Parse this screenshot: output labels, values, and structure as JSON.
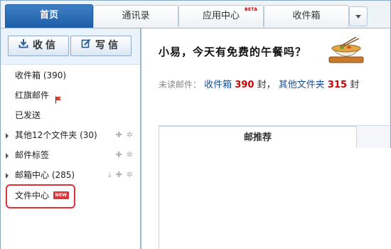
{
  "tabs": [
    {
      "label": "首页",
      "active": true
    },
    {
      "label": "通讯录",
      "active": false
    },
    {
      "label": "应用中心",
      "active": false,
      "badge": "BETA"
    },
    {
      "label": "收件箱",
      "active": false
    }
  ],
  "toolbar": {
    "receive_label": "收信",
    "compose_label": "写信"
  },
  "sidebar": {
    "items": [
      {
        "label": "收件箱 (390)"
      },
      {
        "label": "红旗邮件"
      },
      {
        "label": "已发送"
      },
      {
        "label": "其他12个文件夹 (30)"
      },
      {
        "label": "邮件标签"
      },
      {
        "label": "邮箱中心 (285)"
      },
      {
        "label": "文件中心",
        "badge": "NEW"
      }
    ]
  },
  "main": {
    "greeting": "小易，今天有免费的午餐吗？",
    "unread_label": "未读邮件：",
    "inbox_label": "收件箱",
    "inbox_count": "390",
    "unit1": "封，",
    "other_label": "其他文件夹",
    "other_count": "315",
    "unit2": "封",
    "panel_tab": "邮推荐"
  },
  "colors": {
    "accent": "#1d5ea8",
    "count_red": "#cc0000",
    "link_blue": "#1a4f95",
    "highlight": "#e0303a"
  }
}
